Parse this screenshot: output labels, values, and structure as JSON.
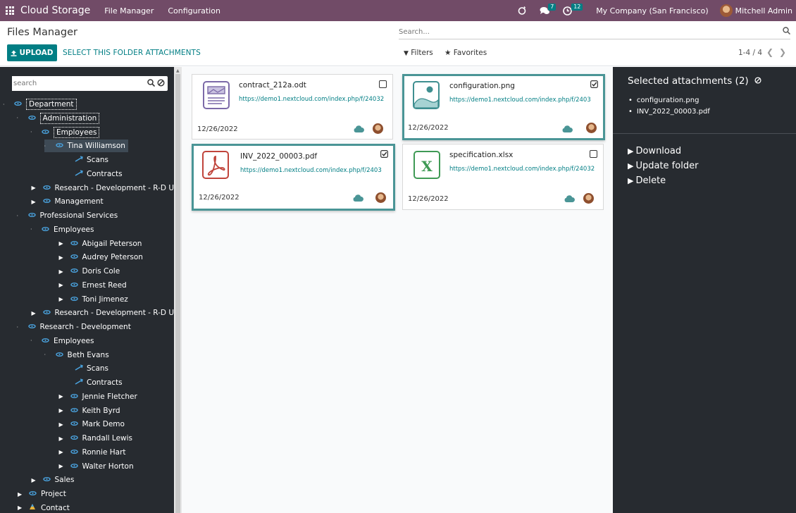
{
  "topbar": {
    "app_name": "Cloud Storage",
    "menu": [
      "File Manager",
      "Configuration"
    ],
    "messages_count": "7",
    "activities_count": "12",
    "company": "My Company (San Francisco)",
    "user": "Mitchell Admin"
  },
  "control_panel": {
    "title": "Files Manager",
    "upload_label": "UPLOAD",
    "select_folder_label": "SELECT THIS FOLDER ATTACHMENTS",
    "search_placeholder": "Search...",
    "filters_label": "Filters",
    "favorites_label": "Favorites",
    "pager": "1-4 / 4"
  },
  "tree": {
    "search_placeholder": "search",
    "nodes": [
      {
        "label": "Department",
        "level": 0,
        "state": "open",
        "style": "dotted"
      },
      {
        "label": "Administration",
        "level": 1,
        "state": "open",
        "style": "dotted"
      },
      {
        "label": "Employees",
        "level": 2,
        "state": "open",
        "style": "dotted"
      },
      {
        "label": "Tina Williamson",
        "level": 3,
        "state": "open",
        "style": "selected"
      },
      {
        "label": "Scans",
        "level": 4,
        "state": "leaf",
        "style": ""
      },
      {
        "label": "Contracts",
        "level": 4,
        "state": "leaf",
        "style": ""
      },
      {
        "label": "Research - Development - R-D USA - Lo",
        "level": 1,
        "state": "closed",
        "style": ""
      },
      {
        "label": "Management",
        "level": 1,
        "state": "closed",
        "style": ""
      },
      {
        "label": "Professional Services",
        "level": 1,
        "state": "open",
        "style": ""
      },
      {
        "label": "Employees",
        "level": 2,
        "state": "open",
        "style": ""
      },
      {
        "label": "Abigail Peterson",
        "level": 3,
        "state": "closed",
        "style": ""
      },
      {
        "label": "Audrey Peterson",
        "level": 3,
        "state": "closed",
        "style": ""
      },
      {
        "label": "Doris Cole",
        "level": 3,
        "state": "closed",
        "style": ""
      },
      {
        "label": "Ernest Reed",
        "level": 3,
        "state": "closed",
        "style": ""
      },
      {
        "label": "Toni Jimenez",
        "level": 3,
        "state": "closed",
        "style": ""
      },
      {
        "label": "Research - Development - R-D USA",
        "level": 1,
        "state": "closed",
        "style": ""
      },
      {
        "label": "Research - Development",
        "level": 1,
        "state": "open",
        "style": ""
      },
      {
        "label": "Employees",
        "level": 2,
        "state": "open",
        "style": ""
      },
      {
        "label": "Beth Evans",
        "level": 3,
        "state": "open",
        "style": ""
      },
      {
        "label": "Scans",
        "level": 4,
        "state": "leaf",
        "style": ""
      },
      {
        "label": "Contracts",
        "level": 4,
        "state": "leaf",
        "style": ""
      },
      {
        "label": "Jennie Fletcher",
        "level": 3,
        "state": "closed",
        "style": ""
      },
      {
        "label": "Keith Byrd",
        "level": 3,
        "state": "closed",
        "style": ""
      },
      {
        "label": "Mark Demo",
        "level": 3,
        "state": "closed",
        "style": ""
      },
      {
        "label": "Randall Lewis",
        "level": 3,
        "state": "closed",
        "style": ""
      },
      {
        "label": "Ronnie Hart",
        "level": 3,
        "state": "closed",
        "style": ""
      },
      {
        "label": "Walter Horton",
        "level": 3,
        "state": "closed",
        "style": ""
      },
      {
        "label": "Sales",
        "level": 1,
        "state": "closed",
        "style": ""
      },
      {
        "label": "Project",
        "level": 0,
        "state": "closed",
        "style": ""
      },
      {
        "label": "Contact",
        "level": 0,
        "state": "closed",
        "style": ""
      }
    ]
  },
  "cards": [
    {
      "name": "contract_212a.odt",
      "url": "https://demo1.nextcloud.com/index.php/f/24032",
      "date": "12/26/2022",
      "selected": false,
      "type": "odt"
    },
    {
      "name": "configuration.png",
      "url": "https://demo1.nextcloud.com/index.php/f/2403",
      "date": "12/26/2022",
      "selected": true,
      "type": "png"
    },
    {
      "name": "INV_2022_00003.pdf",
      "url": "https://demo1.nextcloud.com/index.php/f/2403",
      "date": "12/26/2022",
      "selected": true,
      "type": "pdf"
    },
    {
      "name": "specification.xlsx",
      "url": "https://demo1.nextcloud.com/index.php/f/24032",
      "date": "12/26/2022",
      "selected": false,
      "type": "xlsx"
    }
  ],
  "right_panel": {
    "title": "Selected attachments (2)",
    "items": [
      "configuration.png",
      "INV_2022_00003.pdf"
    ],
    "actions": [
      "Download",
      "Update folder",
      "Delete"
    ]
  },
  "colors": {
    "topbar": "#714b67",
    "accent": "#017e84",
    "dark_panel": "#272b30",
    "selected_border": "#4a9596"
  }
}
